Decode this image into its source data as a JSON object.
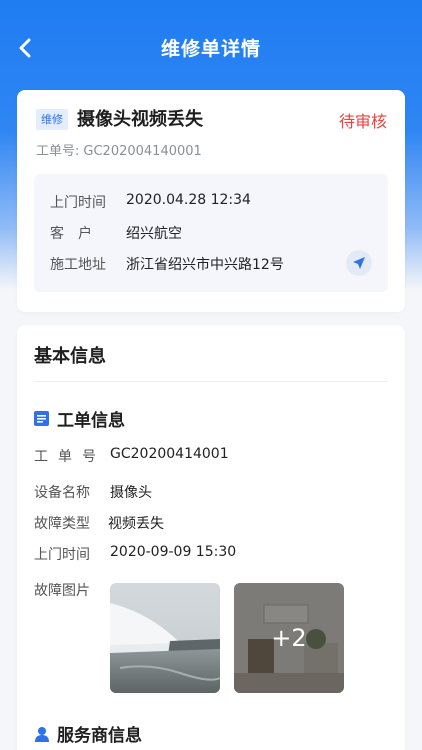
{
  "nav": {
    "title": "维修单详情",
    "back_icon": "chevron-left-icon"
  },
  "order": {
    "tag": "维修",
    "title": "摄像头视频丢失",
    "status": "待审核",
    "status_color": "#e8453c",
    "number_label": "工单号:",
    "number_value": "GC202004140001",
    "visit_time_label": "上门时间",
    "visit_time_value": "2020.04.28 12:34",
    "customer_label": "客户",
    "customer_value": "绍兴航空",
    "address_label": "施工地址",
    "address_value": "浙江省绍兴市中兴路12号"
  },
  "basic": {
    "title": "基本信息",
    "work_order_heading": "工单信息",
    "fields": [
      {
        "label": "工单号",
        "value": "GC20200414001"
      },
      {
        "label": "设备名称",
        "value": "摄像头"
      },
      {
        "label": "故障类型",
        "value": "视频丢失"
      },
      {
        "label": "上门时间",
        "value": "2020-09-09 15:30"
      },
      {
        "label": "故障图片",
        "value": ""
      }
    ],
    "more_photos": "+2",
    "provider_heading": "服务商信息"
  },
  "colors": {
    "accent": "#1f7cf2",
    "tag_bg": "#e3edfd"
  }
}
